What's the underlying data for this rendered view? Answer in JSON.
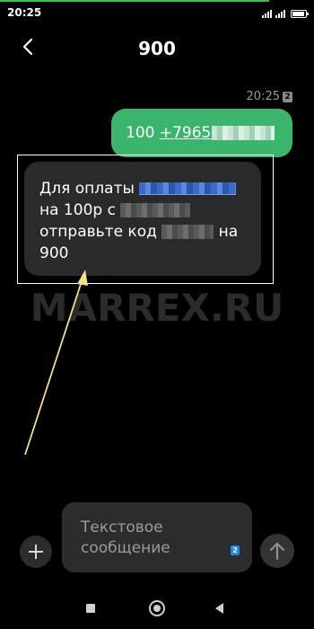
{
  "status_bar": {
    "time": "20:25",
    "battery_level": 0.9
  },
  "header": {
    "title": "900",
    "back_icon": "chevron-left-icon"
  },
  "conversation": {
    "timestamp": "20:25",
    "sim_slot": "2",
    "outgoing": {
      "prefix": "100 ",
      "phone_visible": "+7965"
    },
    "incoming": {
      "line1": "Для оплаты ",
      "line2": "на 100р с ",
      "line3_start": "отправьте код ",
      "line3_end": " на",
      "line4": "900"
    }
  },
  "watermark": "MARREX.RU",
  "composer": {
    "placeholder": "Текстовое сообщение",
    "sim_slot": "2",
    "add_icon": "plus-icon",
    "send_icon": "arrow-up-icon"
  },
  "colors": {
    "outgoing_bubble": "#3bb56b",
    "incoming_bubble": "#2a2a2a",
    "background": "#000000",
    "accent_line": "#3cbf5a",
    "annotation_arrow": "#f5e08a"
  }
}
